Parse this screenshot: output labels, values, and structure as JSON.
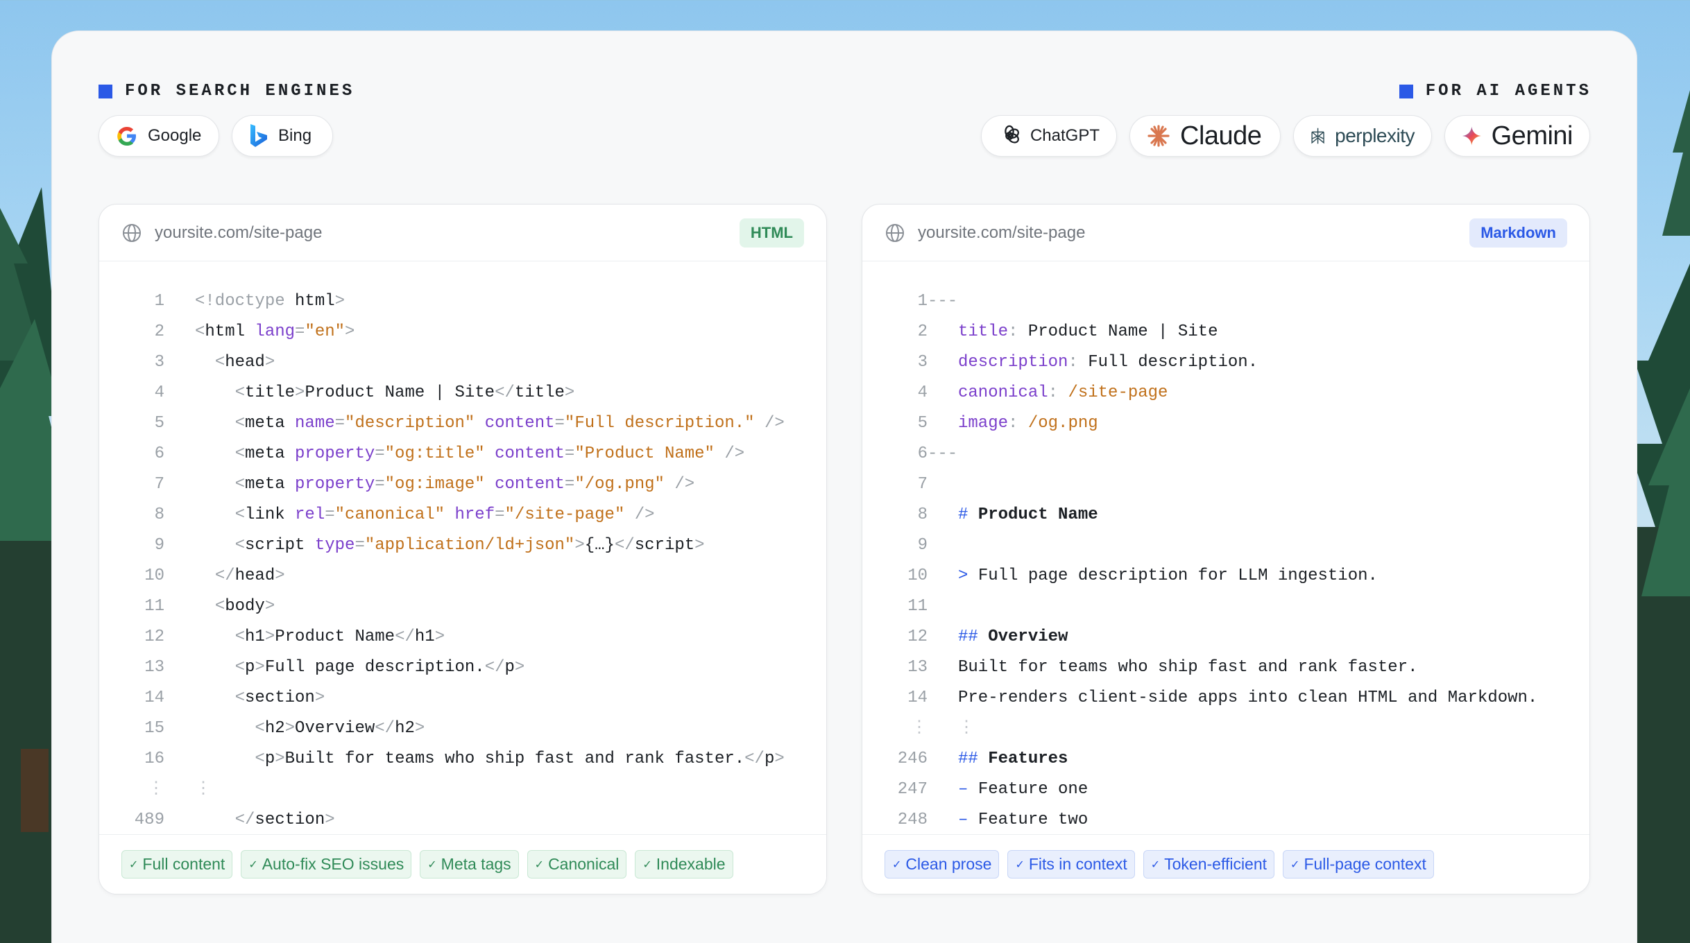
{
  "sections": {
    "search_engines": "FOR SEARCH ENGINES",
    "ai_agents": "FOR AI AGENTS"
  },
  "search_pills": [
    {
      "label": "Google",
      "icon": "google-icon"
    },
    {
      "label": "Bing",
      "icon": "bing-icon"
    }
  ],
  "ai_pills": [
    {
      "label": "ChatGPT",
      "icon": "chatgpt-icon"
    },
    {
      "label": "Claude",
      "icon": "claude-icon"
    },
    {
      "label": "perplexity",
      "icon": "perplexity-icon"
    },
    {
      "label": "Gemini",
      "icon": "gemini-icon"
    }
  ],
  "left_panel": {
    "url": "yoursite.com/site-page",
    "badge": "HTML",
    "chips": [
      "Full content",
      "Auto-fix SEO issues",
      "Meta tags",
      "Canonical",
      "Indexable"
    ]
  },
  "right_panel": {
    "url": "yoursite.com/site-page",
    "badge": "Markdown",
    "chips": [
      "Clean prose",
      "Fits in context",
      "Token-efficient",
      "Full-page context"
    ]
  },
  "html_code": {
    "numbers": [
      "1",
      "2",
      "3",
      "4",
      "5",
      "6",
      "7",
      "8",
      "9",
      "10",
      "11",
      "12",
      "13",
      "14",
      "15",
      "16",
      "⋮",
      "489"
    ],
    "l1": "<!doctype ",
    "l1b": "html",
    "l1c": ">",
    "title_text": "Product Name | Site",
    "desc_val": "\"description\"",
    "content_desc": "\"Full description.\"",
    "og_title": "\"og:title\"",
    "content_title": "\"Product Name\"",
    "og_image": "\"og:image\"",
    "content_image": "\"/og.png\"",
    "canonical_rel": "\"canonical\"",
    "href_val": "\"/site-page\"",
    "script_type": "\"application/ld+json\"",
    "script_body": "{…}",
    "h1_text": "Product Name",
    "p_text": "Full page description.",
    "h2_text": "Overview",
    "p2_text": "Built for teams who ship fast and rank faster."
  },
  "md_code": {
    "numbers": [
      "1",
      "2",
      "3",
      "4",
      "5",
      "6",
      "7",
      "8",
      "9",
      "10",
      "11",
      "12",
      "13",
      "14",
      "⋮",
      "246",
      "247",
      "248"
    ],
    "fm": "---",
    "title_key": "title",
    "title_val": "Product Name | Site",
    "desc_key": "description",
    "desc_val": "Full description.",
    "canon_key": "canonical",
    "canon_val": "/site-page",
    "image_key": "image",
    "image_val": "/og.png",
    "h1": "Product Name",
    "quote": "Full page description for LLM ingestion.",
    "h2a": "Overview",
    "body1": "Built for teams who ship fast and rank faster.",
    "body2": "Pre-renders client-side apps into clean HTML and Markdown.",
    "h2b": "Features",
    "li1": "Feature one",
    "li2": "Feature two"
  }
}
